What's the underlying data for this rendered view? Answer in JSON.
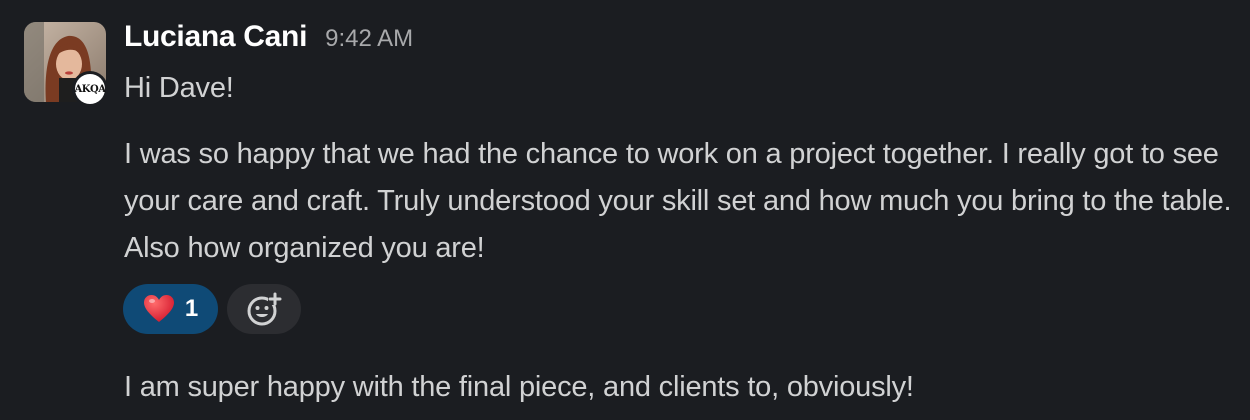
{
  "message": {
    "sender_name": "Luciana Cani",
    "timestamp": "9:42 AM",
    "badge_text": "AKQA",
    "greeting": "Hi Dave!",
    "body": "I was so happy that we had the chance to work on a project together. I really got to see your care and craft. Truly understood your skill set and how much you bring to the table. Also how organized you are!",
    "final": "I am super happy with the final piece, and clients to, obviously!"
  },
  "reactions": [
    {
      "emoji": "heart-icon",
      "count": "1",
      "color": "#0f4a76"
    }
  ],
  "add_reaction_icon": "add-reaction-icon",
  "colors": {
    "background": "#1b1d21",
    "text": "#d1d2d3",
    "name": "#ffffff",
    "timestamp": "#a8a9ab",
    "reaction_active": "#0f4a76",
    "add_reaction_bg": "#2c2d31"
  }
}
